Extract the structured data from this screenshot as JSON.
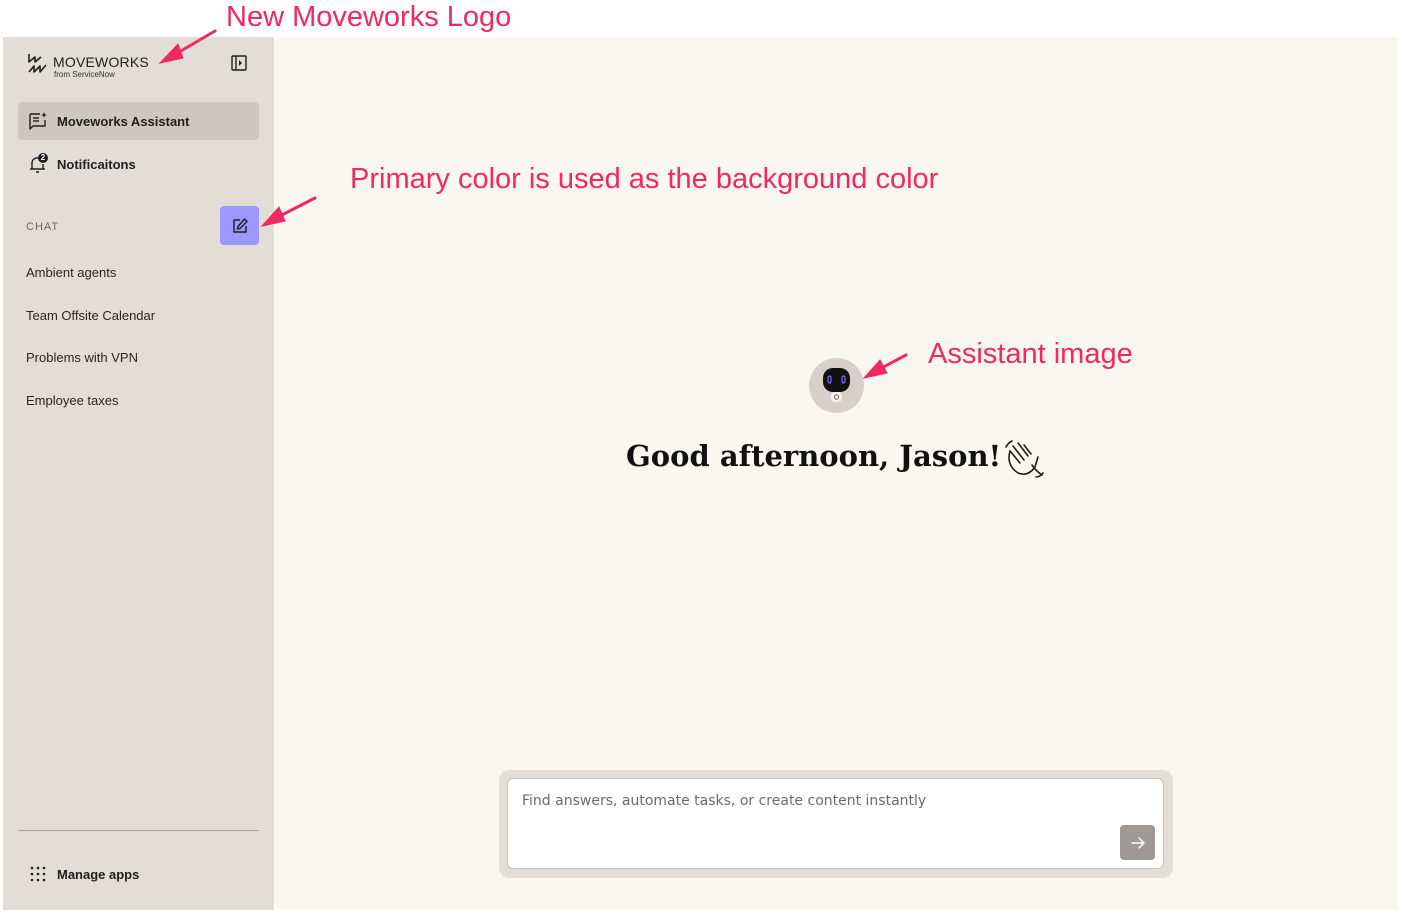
{
  "sidebar": {
    "logo": {
      "name": "MOVEWORKS",
      "subtitle": "from ServiceNow"
    },
    "nav": [
      {
        "label": "Moveworks Assistant",
        "icon": "assistant-chat-icon",
        "active": true
      },
      {
        "label": "Notificaitons",
        "icon": "bell-icon",
        "badge": "2",
        "active": false
      }
    ],
    "chat_section_label": "CHAT",
    "new_chat_icon": "edit-icon",
    "chats": [
      "Ambient agents",
      "Team Offsite Calendar",
      "Problems with VPN",
      "Employee taxes"
    ],
    "manage_apps_label": "Manage apps"
  },
  "main": {
    "greeting": "Good afternoon, Jason!",
    "input_placeholder": "Find answers, automate tasks, or create content instantly",
    "send_icon": "arrow-right-icon"
  },
  "annotations": {
    "logo_note": "New Moveworks Logo",
    "primary_color_note": "Primary color is used as the background color",
    "assistant_image_note": "Assistant image"
  },
  "colors": {
    "primary": "#9b99ff",
    "sidebar_bg": "#e3ddd7",
    "main_bg": "#faf7f0",
    "annotation": "#f0295f"
  }
}
